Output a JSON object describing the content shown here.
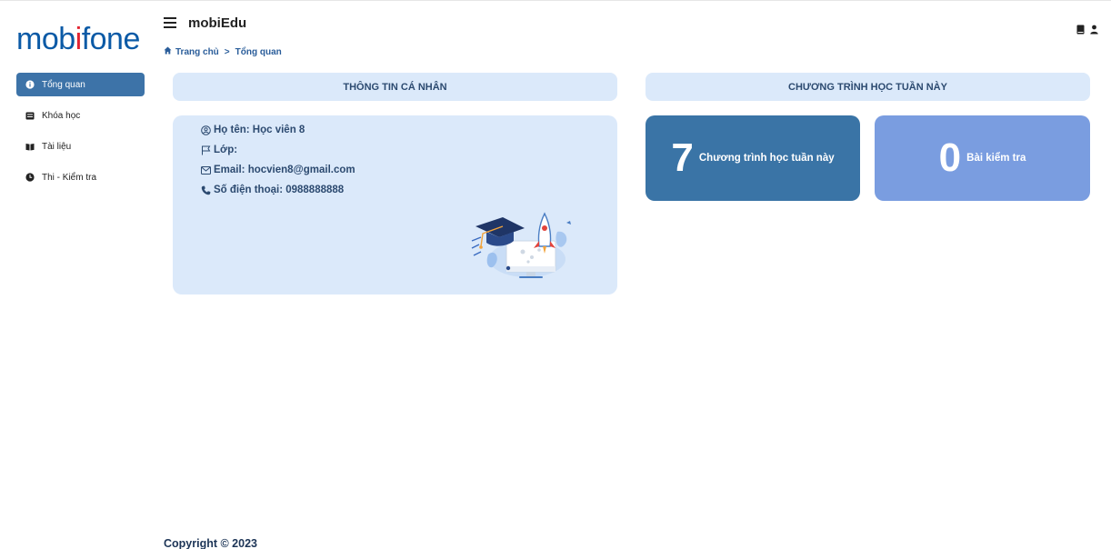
{
  "brand": {
    "logo_text_before": "mob",
    "logo_text_i": "i",
    "logo_text_after": "fone"
  },
  "header": {
    "app_title": "mobiEdu"
  },
  "breadcrumb": {
    "home": "Trang chủ",
    "separator": ">",
    "current": "Tổng quan"
  },
  "sidebar": {
    "items": [
      {
        "label": "Tổng quan",
        "icon": "info-circle-icon",
        "active": true
      },
      {
        "label": "Khóa học",
        "icon": "book-icon",
        "active": false
      },
      {
        "label": "Tài liệu",
        "icon": "open-book-icon",
        "active": false
      },
      {
        "label": "Thi - Kiểm tra",
        "icon": "clock-icon",
        "active": false
      }
    ]
  },
  "personal": {
    "heading": "THÔNG TIN CÁ NHÂN",
    "name": "Họ tên: Học viên 8",
    "class": "Lớp:",
    "email": "Email: hocvien8@gmail.com",
    "phone": "Số điện thoại: 0988888888"
  },
  "program": {
    "heading": "CHƯƠNG TRÌNH HỌC TUẦN NÀY",
    "programs_count": "7",
    "programs_label": "Chương trình học tuần này",
    "tests_count": "0",
    "tests_label": "Bài kiểm tra"
  },
  "colors": {
    "accent": "#3d73a8",
    "panel_bg": "#dbe9fa",
    "stat_programs": "#3a74a6",
    "stat_tests": "#7a9de0",
    "logo_blue": "#0b5aa6",
    "logo_red": "#e22331"
  },
  "footer": {
    "copyright": "Copyright © 2023"
  }
}
